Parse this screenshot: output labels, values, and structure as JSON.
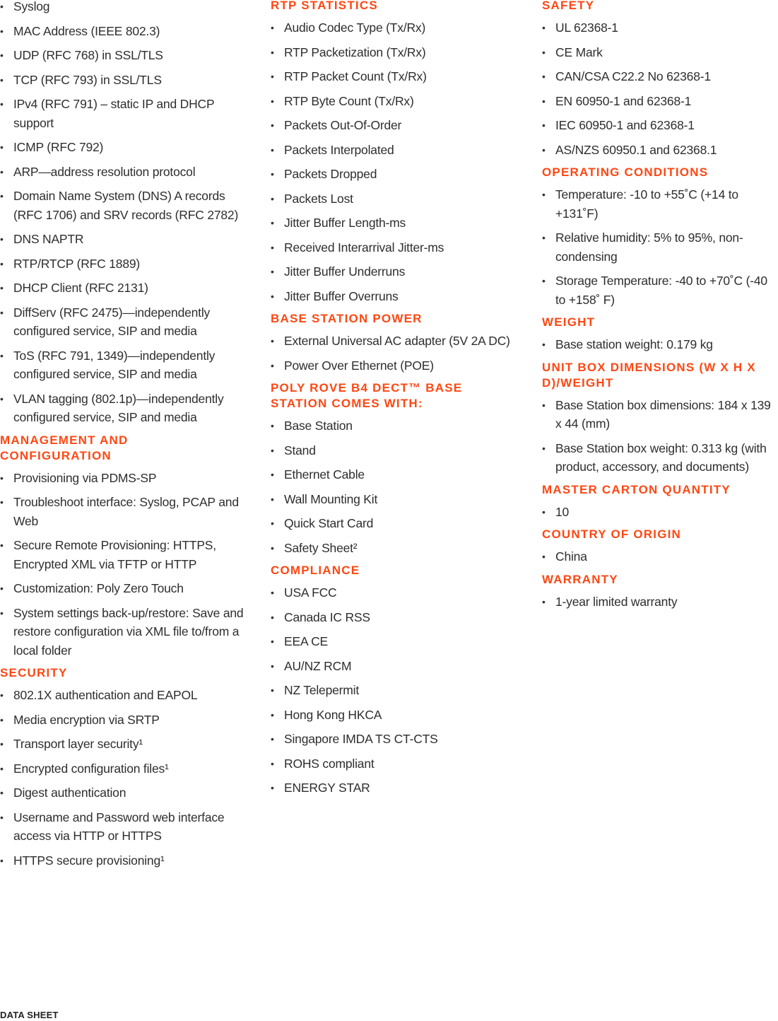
{
  "columns": [
    {
      "sections": [
        {
          "heading": "",
          "items": [
            "Syslog",
            "MAC Address (IEEE 802.3)",
            "UDP (RFC 768) in SSL/TLS",
            "TCP (RFC 793) in SSL/TLS",
            "IPv4 (RFC 791) – static IP and DHCP support",
            "ICMP (RFC 792)",
            "ARP—address resolution protocol",
            "Domain Name System (DNS) A records (RFC 1706) and SRV records (RFC 2782)",
            "DNS NAPTR",
            "RTP/RTCP (RFC 1889)",
            "DHCP Client (RFC 2131)",
            "DiffServ (RFC 2475)—independently configured service, SIP and media",
            "ToS (RFC 791, 1349)—independently configured service, SIP and media",
            "VLAN tagging (802.1p)—independently configured service, SIP and media"
          ]
        },
        {
          "heading": "MANAGEMENT AND CONFIGURATION",
          "items": [
            "Provisioning via PDMS-SP",
            "Troubleshoot interface: Syslog, PCAP and Web",
            "Secure Remote Provisioning: HTTPS, Encrypted XML via TFTP or HTTP",
            "Customization: Poly Zero Touch",
            "System settings back-up/restore: Save and restore configuration via XML file to/from a local folder"
          ]
        },
        {
          "heading": "SECURITY",
          "items": [
            "802.1X authentication and EAPOL",
            "Media encryption via SRTP",
            "Transport layer security¹",
            "Encrypted configuration files¹",
            "Digest authentication",
            "Username and Password web interface access via HTTP or HTTPS",
            "HTTPS secure provisioning¹"
          ]
        }
      ]
    },
    {
      "sections": [
        {
          "heading": "RTP STATISTICS",
          "items": [
            "Audio Codec Type (Tx/Rx)",
            "RTP Packetization (Tx/Rx)",
            "RTP Packet Count (Tx/Rx)",
            "RTP Byte Count (Tx/Rx)",
            "Packets Out-Of-Order",
            "Packets Interpolated",
            "Packets Dropped",
            "Packets Lost",
            "Jitter Buffer Length-ms",
            "Received Interarrival Jitter-ms",
            "Jitter Buffer Underruns",
            "Jitter Buffer Overruns"
          ]
        },
        {
          "heading": "BASE STATION POWER",
          "items": [
            "External Universal AC adapter (5V 2A DC)",
            "Power Over Ethernet (POE)"
          ]
        },
        {
          "heading": "POLY ROVE B4 DECT™ BASE STATION COMES WITH:",
          "items": [
            "Base Station",
            "Stand",
            "Ethernet Cable",
            "Wall Mounting Kit",
            "Quick Start Card",
            "Safety Sheet²"
          ]
        },
        {
          "heading": "COMPLIANCE",
          "items": [
            "USA FCC",
            "Canada IC RSS",
            "EEA CE",
            "AU/NZ RCM",
            "NZ Telepermit",
            "Hong Kong HKCA",
            "Singapore IMDA TS CT-CTS",
            "ROHS compliant",
            "ENERGY STAR"
          ]
        }
      ]
    },
    {
      "sections": [
        {
          "heading": "SAFETY",
          "items": [
            "UL 62368-1",
            "CE Mark",
            "CAN/CSA C22.2 No 62368-1",
            "EN 60950-1 and 62368-1",
            "IEC 60950-1 and 62368-1",
            "AS/NZS 60950.1 and 62368.1"
          ]
        },
        {
          "heading": "OPERATING CONDITIONS",
          "items": [
            "Temperature: -10 to +55˚C (+14 to +131˚F)",
            "Relative humidity: 5% to 95%, non-condensing",
            "Storage Temperature: -40 to +70˚C (-40 to +158˚ F)"
          ]
        },
        {
          "heading": "WEIGHT",
          "items": [
            "Base station weight: 0.179 kg"
          ]
        },
        {
          "heading": "UNIT BOX DIMENSIONS (W X H X D)/WEIGHT",
          "items": [
            "Base Station box dimensions: 184 x 139 x 44 (mm)",
            "Base Station box weight: 0.313 kg (with product, accessory, and documents)"
          ]
        },
        {
          "heading": "MASTER CARTON QUANTITY",
          "items": [
            "10"
          ]
        },
        {
          "heading": "COUNTRY OF ORIGIN",
          "items": [
            "China"
          ]
        },
        {
          "heading": "WARRANTY",
          "items": [
            "1-year limited warranty"
          ]
        }
      ]
    }
  ],
  "footer": {
    "label": "DATA SHEET"
  },
  "colors": {
    "heading": "#ff4713",
    "text": "#2e2e2e"
  }
}
